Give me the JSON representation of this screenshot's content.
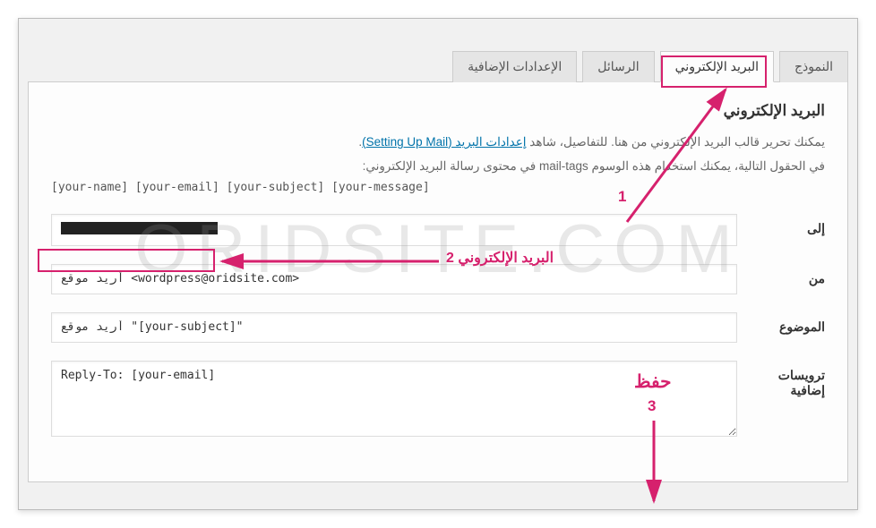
{
  "tabs": {
    "form": "النموذج",
    "mail": "البريد الإلكتروني",
    "messages": "الرسائل",
    "additional": "الإعدادات الإضافية"
  },
  "section_title": "البريد الإلكتروني",
  "desc_line1_a": "يمكنك تحرير قالب البريد الإلكتروني من هنا. للتفاصيل، شاهد ",
  "desc_link": "إعدادات البريد (Setting Up Mail)",
  "desc_line1_b": ".",
  "desc_line2": "في الحقول التالية، يمكنك استخدام هذه الوسوم mail-tags في محتوى رسالة البريد الإلكتروني:",
  "mail_tags": "[your-name] [your-email] [your-subject] [your-message]",
  "fields": {
    "to_label": "إلى",
    "from_label": "من",
    "from_value": "أريد موقع <wordpress@oridsite.com>",
    "subject_label": "الموضوع",
    "subject_value": "أريد موقع \"[your-subject]\"",
    "headers_label": "ترويسات إضافية",
    "headers_value": "Reply-To: [your-email]"
  },
  "annotations": {
    "step1": "1",
    "step2_text": "البريد الإلكتروني  2",
    "save_text": "حفظ",
    "step3": "3"
  },
  "watermark": "ORIDSITE.COM"
}
